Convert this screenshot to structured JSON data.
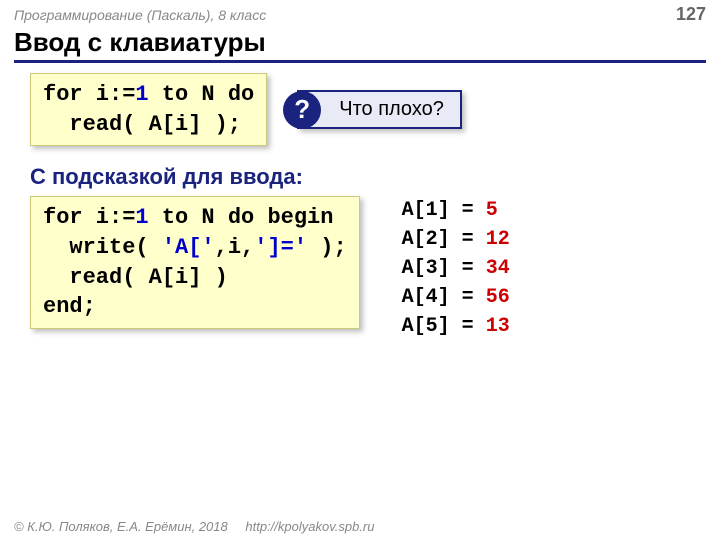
{
  "header": {
    "course": "Программирование (Паскаль), 8 класс",
    "page": "127"
  },
  "title": "Ввод с клавиатуры",
  "code1": {
    "l1a": "for i:=",
    "l1b": "1",
    "l1c": " to N do",
    "l2": "  read( A[i] );"
  },
  "bad": {
    "icon": "?",
    "text": "Что плохо?"
  },
  "subhead": "С подсказкой для ввода:",
  "code2": {
    "l1a": "for i:=",
    "l1b": "1",
    "l1c": " to N do begin",
    "l2a": "  write( ",
    "l2b": "'A['",
    "l2c": ",i,",
    "l2d": "']='",
    "l2e": " );",
    "l3": "  read( A[i] )",
    "l4": "end;"
  },
  "output": [
    {
      "label": "A[1] = ",
      "value": "5"
    },
    {
      "label": "A[2] = ",
      "value": "12"
    },
    {
      "label": "A[3] = ",
      "value": "34"
    },
    {
      "label": "A[4] = ",
      "value": "56"
    },
    {
      "label": "A[5] = ",
      "value": "13"
    }
  ],
  "footer": {
    "copyright": "© К.Ю. Поляков, Е.А. Ерёмин, 2018",
    "url": "http://kpolyakov.spb.ru"
  }
}
